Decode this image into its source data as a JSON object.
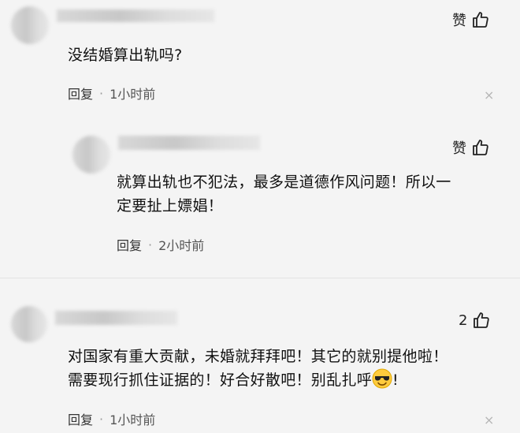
{
  "comments": [
    {
      "text": "没结婚算出轨吗?",
      "reply_label": "回复",
      "separator": "·",
      "time": "1小时前",
      "like_label": "赞",
      "close_glyph": "×"
    },
    {
      "text_line1": "就算出轨也不犯法，最多是道德作风问题！所以一",
      "text_line2": "定要扯上嫖娼！",
      "reply_label": "回复",
      "separator": "·",
      "time": "2小时前",
      "like_label": "赞"
    },
    {
      "text_line1": "对国家有重大贡献，未婚就拜拜吧！其它的就别提他啦！",
      "text_line2": "需要现行抓住证据的！好合好散吧！别乱扎呼",
      "text_line2_end": "!",
      "reply_label": "回复",
      "separator": "·",
      "time": "1小时前",
      "like_count": "2",
      "close_glyph": "×"
    }
  ],
  "icons": [
    "thumbs-up-icon",
    "close-icon",
    "sunglasses-emoji-icon"
  ],
  "colors": {
    "background": "#f4f4f4",
    "text": "#111111",
    "meta": "#555555"
  }
}
